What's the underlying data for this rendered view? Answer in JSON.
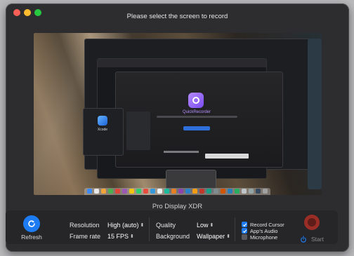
{
  "window": {
    "title": "Please select the screen to record"
  },
  "preview": {
    "app_title": "QuickRecorder",
    "xcode_label": "Xcode"
  },
  "display": {
    "name": "Pro Display XDR"
  },
  "controls": {
    "refresh_label": "Refresh",
    "resolution": {
      "label": "Resolution",
      "value": "High (auto)"
    },
    "frame_rate": {
      "label": "Frame rate",
      "value": "15 FPS"
    },
    "quality": {
      "label": "Quality",
      "value": "Low"
    },
    "background": {
      "label": "Background",
      "value": "Wallpaper"
    },
    "checkboxes": [
      {
        "label": "Record Cursor",
        "checked": true
      },
      {
        "label": "App's Audio",
        "checked": true
      },
      {
        "label": "Microphone",
        "checked": false
      }
    ],
    "start_label": "Start"
  },
  "colors": {
    "accent": "#1d7bf3",
    "record": "#9a2e27"
  }
}
